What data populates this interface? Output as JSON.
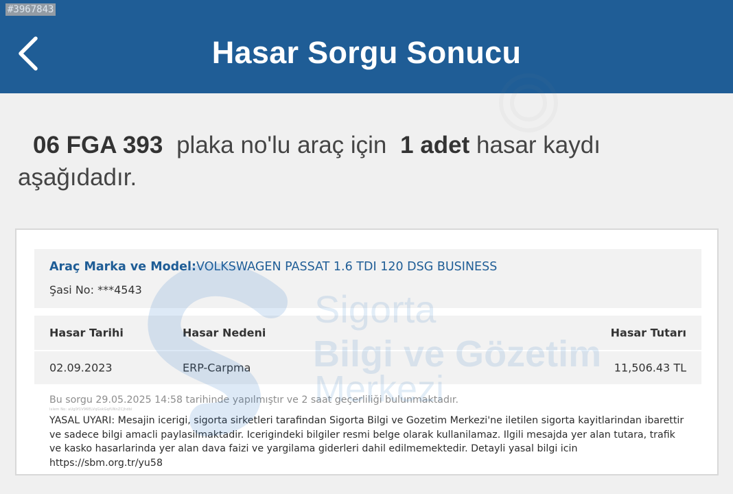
{
  "listing_tag": "#3967843",
  "header": {
    "title": "Hasar Sorgu Sonucu",
    "back_icon": "chevron-left-icon"
  },
  "summary": {
    "plate": "06 FGA 393",
    "text_mid": "plaka no'lu araç için",
    "count": "1 adet",
    "text_end": "hasar kaydı aşağıdadır."
  },
  "vehicle": {
    "make_model_label": "Araç Marka ve Model:",
    "make_model_value": "VOLKSWAGEN PASSAT 1.6 TDI 120 DSG BUSINESS",
    "chassis_label": "Şasi No:",
    "chassis_value": "***4543"
  },
  "damage_table": {
    "columns": [
      "Hasar Tarihi",
      "Hasar Nedeni",
      "Hasar Tutarı"
    ],
    "rows": [
      [
        "02.09.2023",
        "ERP-Carpma",
        "11,506.43 TL"
      ]
    ]
  },
  "query_note": "Bu sorgu 29.05.2025 14:58 tarihinde yapılmıştır ve 2 saat geçerliliği bulunmaktadır.",
  "micro_note": "Islem No: aUg0f1V96ELVqGskGqfUNnZCJhdbl",
  "legal_text": "YASAL UYARI: Mesajin icerigi, sigorta sirketleri tarafindan Sigorta Bilgi ve Gozetim Merkezi'ne iletilen sigorta kayitlarindan ibarettir ve sadece bilgi amacli paylasilmaktadir. Icerigindeki bilgiler resmi belge olarak kullanilamaz. Ilgili mesajda yer alan tutara, trafik ve kasko hasarlarinda yer alan dava faizi ve yargilama giderleri dahil edilmemektedir. Detayli yasal bilgi icin https://sbm.org.tr/yu58",
  "watermark": {
    "line1": "Sigorta",
    "line2": "Bilgi ve Gözetim",
    "line3": "Merkezi"
  },
  "colors": {
    "header_bg": "#1f5d96",
    "accent_text": "#1f5d96",
    "page_bg": "#f0f0f0",
    "row_bg": "#f2f2f2"
  }
}
